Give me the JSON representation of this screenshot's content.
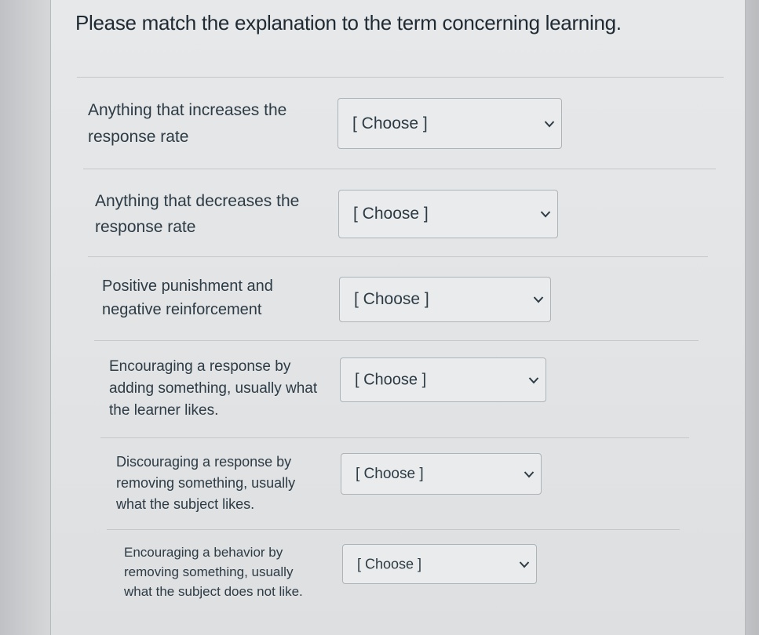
{
  "question": {
    "text": "Please match the explanation to the term concerning learning."
  },
  "rows": [
    {
      "prompt_lines": [
        "Anything that increases the",
        "response rate"
      ],
      "select_value": "[ Choose ]"
    },
    {
      "prompt_lines": [
        "Anything that decreases the",
        "response rate"
      ],
      "select_value": "[ Choose ]"
    },
    {
      "prompt_lines": [
        "Positive punishment and",
        "negative reinforcement"
      ],
      "select_value": "[ Choose ]"
    },
    {
      "prompt_lines": [
        "Encouraging a response by",
        "adding something, usually what",
        "the learner likes."
      ],
      "select_value": "[ Choose ]"
    },
    {
      "prompt_lines": [
        "Discouraging a response by",
        "removing something, usually",
        "what the subject likes."
      ],
      "select_value": "[ Choose ]"
    },
    {
      "prompt_lines": [
        "Encouraging a behavior by",
        "removing something, usually",
        "what the subject does not like."
      ],
      "select_value": "[ Choose ]"
    }
  ],
  "icons": {
    "select_arrow": "chevron-down-icon"
  }
}
